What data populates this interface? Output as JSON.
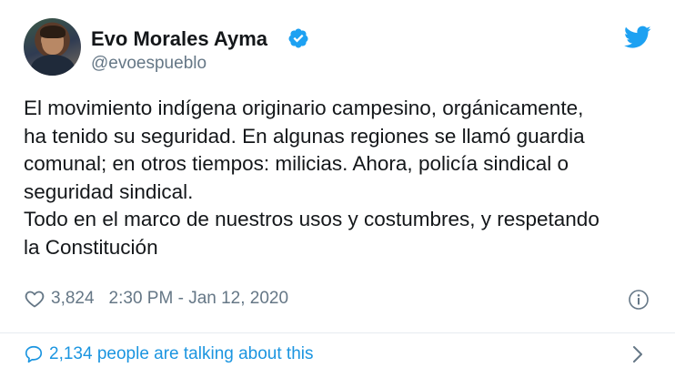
{
  "tweet": {
    "author": {
      "display_name": "Evo Morales Ayma",
      "handle": "@evoespueblo",
      "verified": true
    },
    "text_lines": [
      "El movimiento indígena originario campesino, orgánicamente,",
      "ha tenido su seguridad. En algunas regiones se llamó guardia",
      "comunal; en otros tiempos: milicias. Ahora, policía sindical o",
      "seguridad sindical.",
      "Todo en el marco de nuestros usos y costumbres, y respetando",
      "la Constitución"
    ],
    "likes": "3,824",
    "timestamp": "2:30 PM - Jan 12, 2020",
    "talking": "2,134 people are talking about this"
  },
  "icons": {
    "verified": "verified-badge-icon",
    "brand": "twitter-bird-icon",
    "like": "heart-icon",
    "info": "info-icon",
    "conversation": "speech-bubble-icon",
    "chevron": "chevron-right-icon"
  },
  "colors": {
    "brand_blue": "#1da1f2",
    "link_blue": "#1b95e0",
    "secondary_text": "#657786",
    "primary_text": "#14171a",
    "divider": "#e6ecf0"
  }
}
